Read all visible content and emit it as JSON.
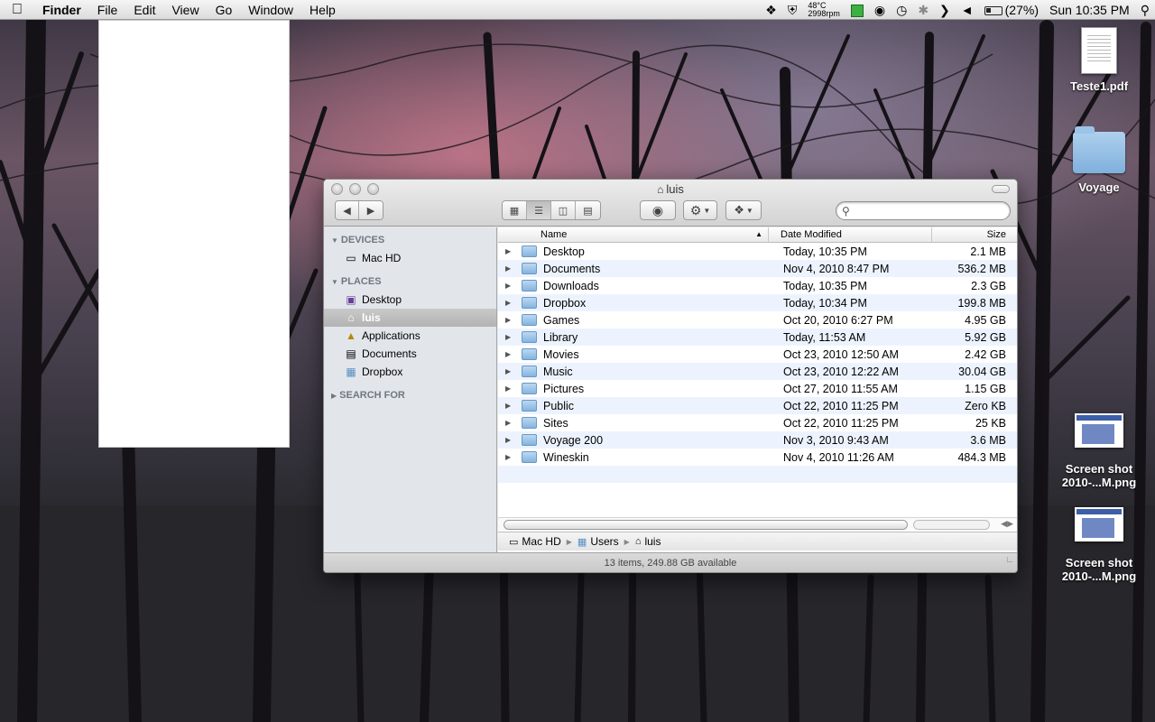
{
  "menubar": {
    "app_name": "Finder",
    "menus": [
      "File",
      "Edit",
      "View",
      "Go",
      "Window",
      "Help"
    ],
    "temp_line1": "48°C",
    "temp_line2": "2998rpm",
    "battery_percent": "(27%)",
    "clock": "Sun 10:35 PM"
  },
  "desktop": {
    "icons": [
      {
        "label": "Teste1.pdf",
        "type": "pdf"
      },
      {
        "label": "Voyage",
        "type": "folder"
      },
      {
        "label_line1": "Screen shot",
        "label_line2": "2010-...M.png",
        "type": "screenshot"
      },
      {
        "label_line1": "Screen shot",
        "label_line2": "2010-...M.png",
        "type": "screenshot"
      }
    ]
  },
  "window": {
    "title": "luis",
    "search_placeholder": "",
    "sidebar": {
      "devices_heading": "DEVICES",
      "devices": [
        {
          "label": "Mac HD",
          "icon": "hard-drive-icon"
        }
      ],
      "places_heading": "PLACES",
      "places": [
        {
          "label": "Desktop",
          "icon": "desktop-icon"
        },
        {
          "label": "luis",
          "icon": "home-icon",
          "selected": true
        },
        {
          "label": "Applications",
          "icon": "applications-icon"
        },
        {
          "label": "Documents",
          "icon": "documents-icon"
        },
        {
          "label": "Dropbox",
          "icon": "dropbox-folder-icon"
        }
      ],
      "search_heading": "SEARCH FOR"
    },
    "columns": {
      "name": "Name",
      "date": "Date Modified",
      "size": "Size"
    },
    "rows": [
      {
        "name": "Desktop",
        "date": "Today, 10:35 PM",
        "size": "2.1 MB"
      },
      {
        "name": "Documents",
        "date": "Nov 4, 2010 8:47 PM",
        "size": "536.2 MB"
      },
      {
        "name": "Downloads",
        "date": "Today, 10:35 PM",
        "size": "2.3 GB"
      },
      {
        "name": "Dropbox",
        "date": "Today, 10:34 PM",
        "size": "199.8 MB"
      },
      {
        "name": "Games",
        "date": "Oct 20, 2010 6:27 PM",
        "size": "4.95 GB"
      },
      {
        "name": "Library",
        "date": "Today, 11:53 AM",
        "size": "5.92 GB"
      },
      {
        "name": "Movies",
        "date": "Oct 23, 2010 12:50 AM",
        "size": "2.42 GB"
      },
      {
        "name": "Music",
        "date": "Oct 23, 2010 12:22 AM",
        "size": "30.04 GB"
      },
      {
        "name": "Pictures",
        "date": "Oct 27, 2010 11:55 AM",
        "size": "1.15 GB"
      },
      {
        "name": "Public",
        "date": "Oct 22, 2010 11:25 PM",
        "size": "Zero KB"
      },
      {
        "name": "Sites",
        "date": "Oct 22, 2010 11:25 PM",
        "size": "25 KB"
      },
      {
        "name": "Voyage 200",
        "date": "Nov 3, 2010 9:43 AM",
        "size": "3.6 MB"
      },
      {
        "name": "Wineskin",
        "date": "Nov 4, 2010 11:26 AM",
        "size": "484.3 MB"
      }
    ],
    "path": [
      "Mac HD",
      "Users",
      "luis"
    ],
    "status": "13 items, 249.88 GB available"
  }
}
